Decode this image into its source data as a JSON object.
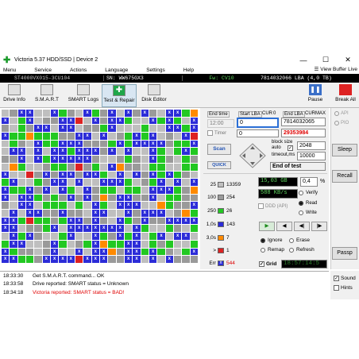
{
  "app": {
    "title": "Victoria 5.37 HDD/SSD | Device 2"
  },
  "window_controls": {
    "min": "—",
    "max": "☐",
    "close": "✕"
  },
  "menu": {
    "items": [
      "Menu",
      "Service",
      "Actions",
      "Language",
      "Settings",
      "Help"
    ],
    "view_buffer": "View Buffer Live"
  },
  "device_bar": {
    "model": "ST4000VX015-3CU104",
    "serial": "SN: WW675GX3",
    "fw": "Fw: CV10",
    "size": "7814032066 LBA (4,0 TB)"
  },
  "toolbar": {
    "drive_info": "Drive Info",
    "smart": "S.M.A.R.T",
    "smart_logs": "SMART Logs",
    "test_repair": "Test & Repair",
    "disk_editor": "Disk Editor",
    "pause": "Pause",
    "break_all": "Break All"
  },
  "test": {
    "end_time_label": "End time",
    "start_lba_label": "Start LBA",
    "cur": "CUR",
    "zero": "0",
    "end_lba_label": "End LBA",
    "max": "MAX",
    "time_value": "12:00",
    "start_lba": "0",
    "end_lba_value": "7814032065",
    "cur_lba": "29353984",
    "timer_label": "Timer",
    "timer_value": "0",
    "block_size_label": "block size",
    "auto_label": "auto",
    "block_size": "2048",
    "timeout_label": "timeout,ms",
    "timeout": "10000",
    "end_of_test": "End of test",
    "scan": "Scan",
    "quick": "QUICK"
  },
  "counters": [
    {
      "tag": "25",
      "val": "13359"
    },
    {
      "tag": "100",
      "val": "254"
    },
    {
      "tag": "250",
      "val": "26"
    },
    {
      "tag": "1,0s",
      "val": "143"
    },
    {
      "tag": "3,0s",
      "val": "7"
    },
    {
      "tag": ">",
      "val": "1"
    },
    {
      "tag": "Err",
      "val": "544"
    }
  ],
  "progress": {
    "read": "15,03 GB",
    "percent": "0,4",
    "percent_sign": "%",
    "speed": "588 KB/s",
    "ddd": "DDD (API)"
  },
  "mode": {
    "verify": "Verify",
    "read": "Read",
    "write": "Write"
  },
  "repair": {
    "ignore": "Ignore",
    "erase": "Erase",
    "remap": "Remap",
    "refresh": "Refresh"
  },
  "grid_label": "Grid",
  "lcd": "18:57:14:5",
  "side": {
    "api": "API",
    "pio": "PIO",
    "sleep": "Sleep",
    "recall": "Recall",
    "passp": "Passp"
  },
  "log": [
    {
      "time": "18:33:30",
      "msg": "Get S.M.A.R.T. command... OK",
      "color": "#000000"
    },
    {
      "time": "18:33:58",
      "msg": "Drive reported: SMART status = Unknown",
      "color": "#000000"
    },
    {
      "time": "18:34:18",
      "msg": "Victoria reported: SMART status = BAD!",
      "color": "#e00000"
    }
  ],
  "log_side": {
    "sound": "Sound",
    "hints": "Hints"
  }
}
